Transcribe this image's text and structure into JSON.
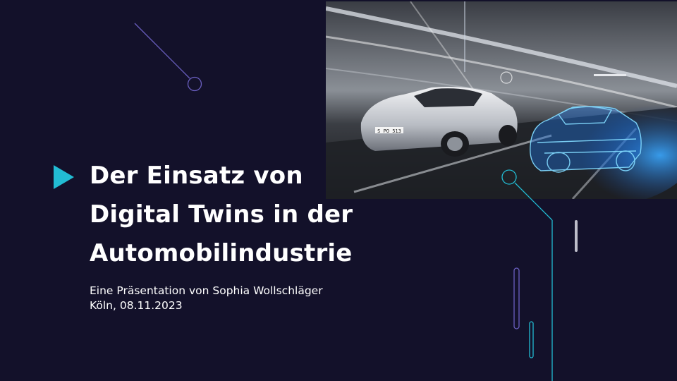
{
  "slide": {
    "title_lines": [
      "Der Einsatz von",
      "Digital Twins in der",
      "Automobilindustrie"
    ],
    "subtitle_lines": [
      "Eine Präsentation von Sophia Wollschläger",
      "Köln, 08.11.2023"
    ],
    "plate_text": "S PO 513"
  },
  "colors": {
    "background": "#13112a",
    "accent": "#22bcd3",
    "accent_purple": "#6a5fc0",
    "text": "#ffffff"
  },
  "icons": {
    "title_marker": "play-triangle-icon"
  }
}
